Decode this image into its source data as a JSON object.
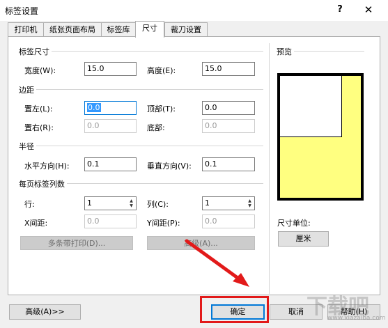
{
  "window": {
    "title": "标签设置",
    "help": "?",
    "close": "✕"
  },
  "tabs": [
    {
      "label": "打印机"
    },
    {
      "label": "纸张页面布局"
    },
    {
      "label": "标签库"
    },
    {
      "label": "尺寸"
    },
    {
      "label": "裁刀设置"
    }
  ],
  "label_size": {
    "section": "标签尺寸",
    "width_label": "宽度(W):",
    "width_value": "15.0",
    "height_label": "高度(E):",
    "height_value": "15.0"
  },
  "margins": {
    "section": "边距",
    "left_label": "置左(L):",
    "left_value": "0.0",
    "top_label": "顶部(T):",
    "top_value": "0.0",
    "right_label": "置右(R):",
    "right_value": "0.0",
    "bottom_label": "底部:",
    "bottom_value": "0.0"
  },
  "radius": {
    "section": "半径",
    "horizontal_label": "水平方向(H):",
    "horizontal_value": "0.1",
    "vertical_label": "垂直方向(V):",
    "vertical_value": "0.1"
  },
  "columns": {
    "section": "每页标签列数",
    "rows_label": "行:",
    "rows_value": "1",
    "cols_label": "列(C):",
    "cols_value": "1",
    "xgap_label": "X间距:",
    "xgap_value": "0.0",
    "ygap_label": "Y间距(P):",
    "ygap_value": "0.0",
    "multi_print_button": "多条带打印(D)...",
    "advanced_button": "高级(A)..."
  },
  "preview": {
    "section": "预览",
    "unit_label": "尺寸单位:",
    "unit_button": "厘米"
  },
  "footer": {
    "advanced": "高级(A)>>",
    "ok": "确定",
    "cancel": "取消",
    "help": "帮助(H)"
  },
  "watermark": {
    "text": "下载吧",
    "url": "www.xiazaiba.com"
  },
  "colors": {
    "accent": "#0078d7",
    "highlight": "#e21a1a",
    "preview_fill": "#ffff80"
  }
}
